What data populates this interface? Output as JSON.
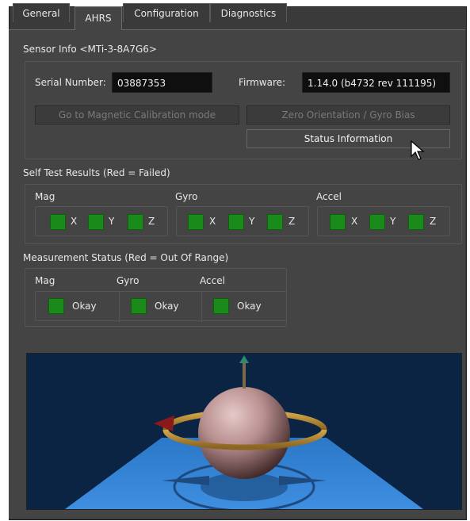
{
  "tabs": [
    {
      "label": "General"
    },
    {
      "label": "AHRS"
    },
    {
      "label": "Configuration"
    },
    {
      "label": "Diagnostics"
    }
  ],
  "sensor_info": {
    "title": "Sensor Info <MTi-3-8A7G6>",
    "serial_label": "Serial Number:",
    "serial_value": "03887353",
    "firmware_label": "Firmware:",
    "firmware_value": "1.14.0 (b4732 rev 111195)",
    "btn_mag_cal": "Go to Magnetic Calibration mode",
    "btn_zero": "Zero Orientation / Gyro Bias",
    "btn_status": "Status Information"
  },
  "self_test": {
    "title": "Self Test Results  (Red = Failed)",
    "groups": [
      {
        "label": "Mag",
        "axes": [
          "X",
          "Y",
          "Z"
        ]
      },
      {
        "label": "Gyro",
        "axes": [
          "X",
          "Y",
          "Z"
        ]
      },
      {
        "label": "Accel",
        "axes": [
          "X",
          "Y",
          "Z"
        ]
      }
    ]
  },
  "measurement": {
    "title": "Measurement Status  (Red = Out Of Range)",
    "groups": [
      {
        "label": "Mag",
        "status": "Okay"
      },
      {
        "label": "Gyro",
        "status": "Okay"
      },
      {
        "label": "Accel",
        "status": "Okay"
      }
    ]
  },
  "colors": {
    "ok_green": "#1a8a1a",
    "panel_bg": "#444444",
    "viewport_bg": "#0b2444",
    "floor_blue": "#2f7fd1"
  },
  "icons": [
    "pointer-cursor-icon"
  ]
}
